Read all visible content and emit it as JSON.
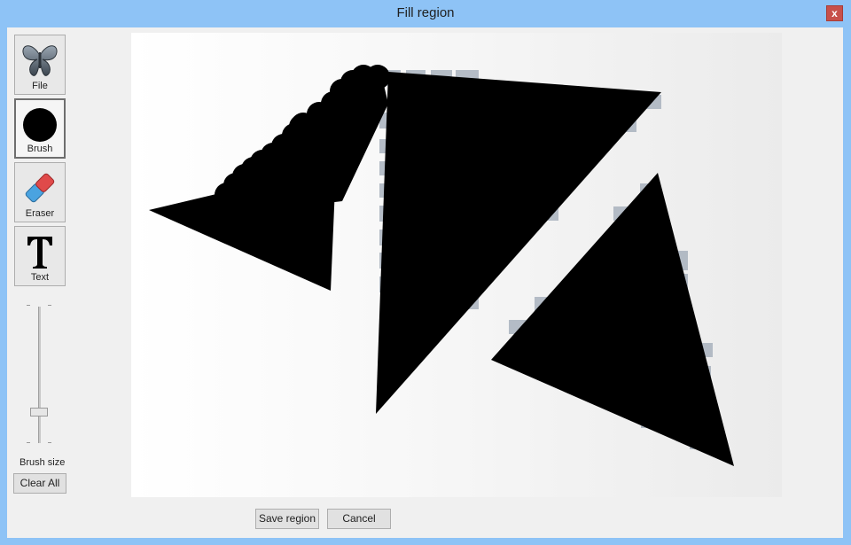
{
  "window": {
    "title": "Fill region",
    "close_label": "x"
  },
  "tools": [
    {
      "id": "file",
      "label": "File",
      "icon": "butterfly-icon",
      "selected": false
    },
    {
      "id": "brush",
      "label": "Brush",
      "icon": "brush-circle-icon",
      "selected": true
    },
    {
      "id": "eraser",
      "label": "Eraser",
      "icon": "eraser-icon",
      "selected": false
    },
    {
      "id": "text",
      "label": "Text",
      "icon": "text-t-icon",
      "selected": false
    }
  ],
  "brush_size": {
    "label": "Brush size",
    "value_fraction": 0.2
  },
  "buttons": {
    "clear_all": "Clear All",
    "save_region": "Save region",
    "cancel": "Cancel"
  },
  "colors": {
    "titlebar": "#8ec3f6",
    "close": "#c7504a",
    "mask": "#000000"
  }
}
